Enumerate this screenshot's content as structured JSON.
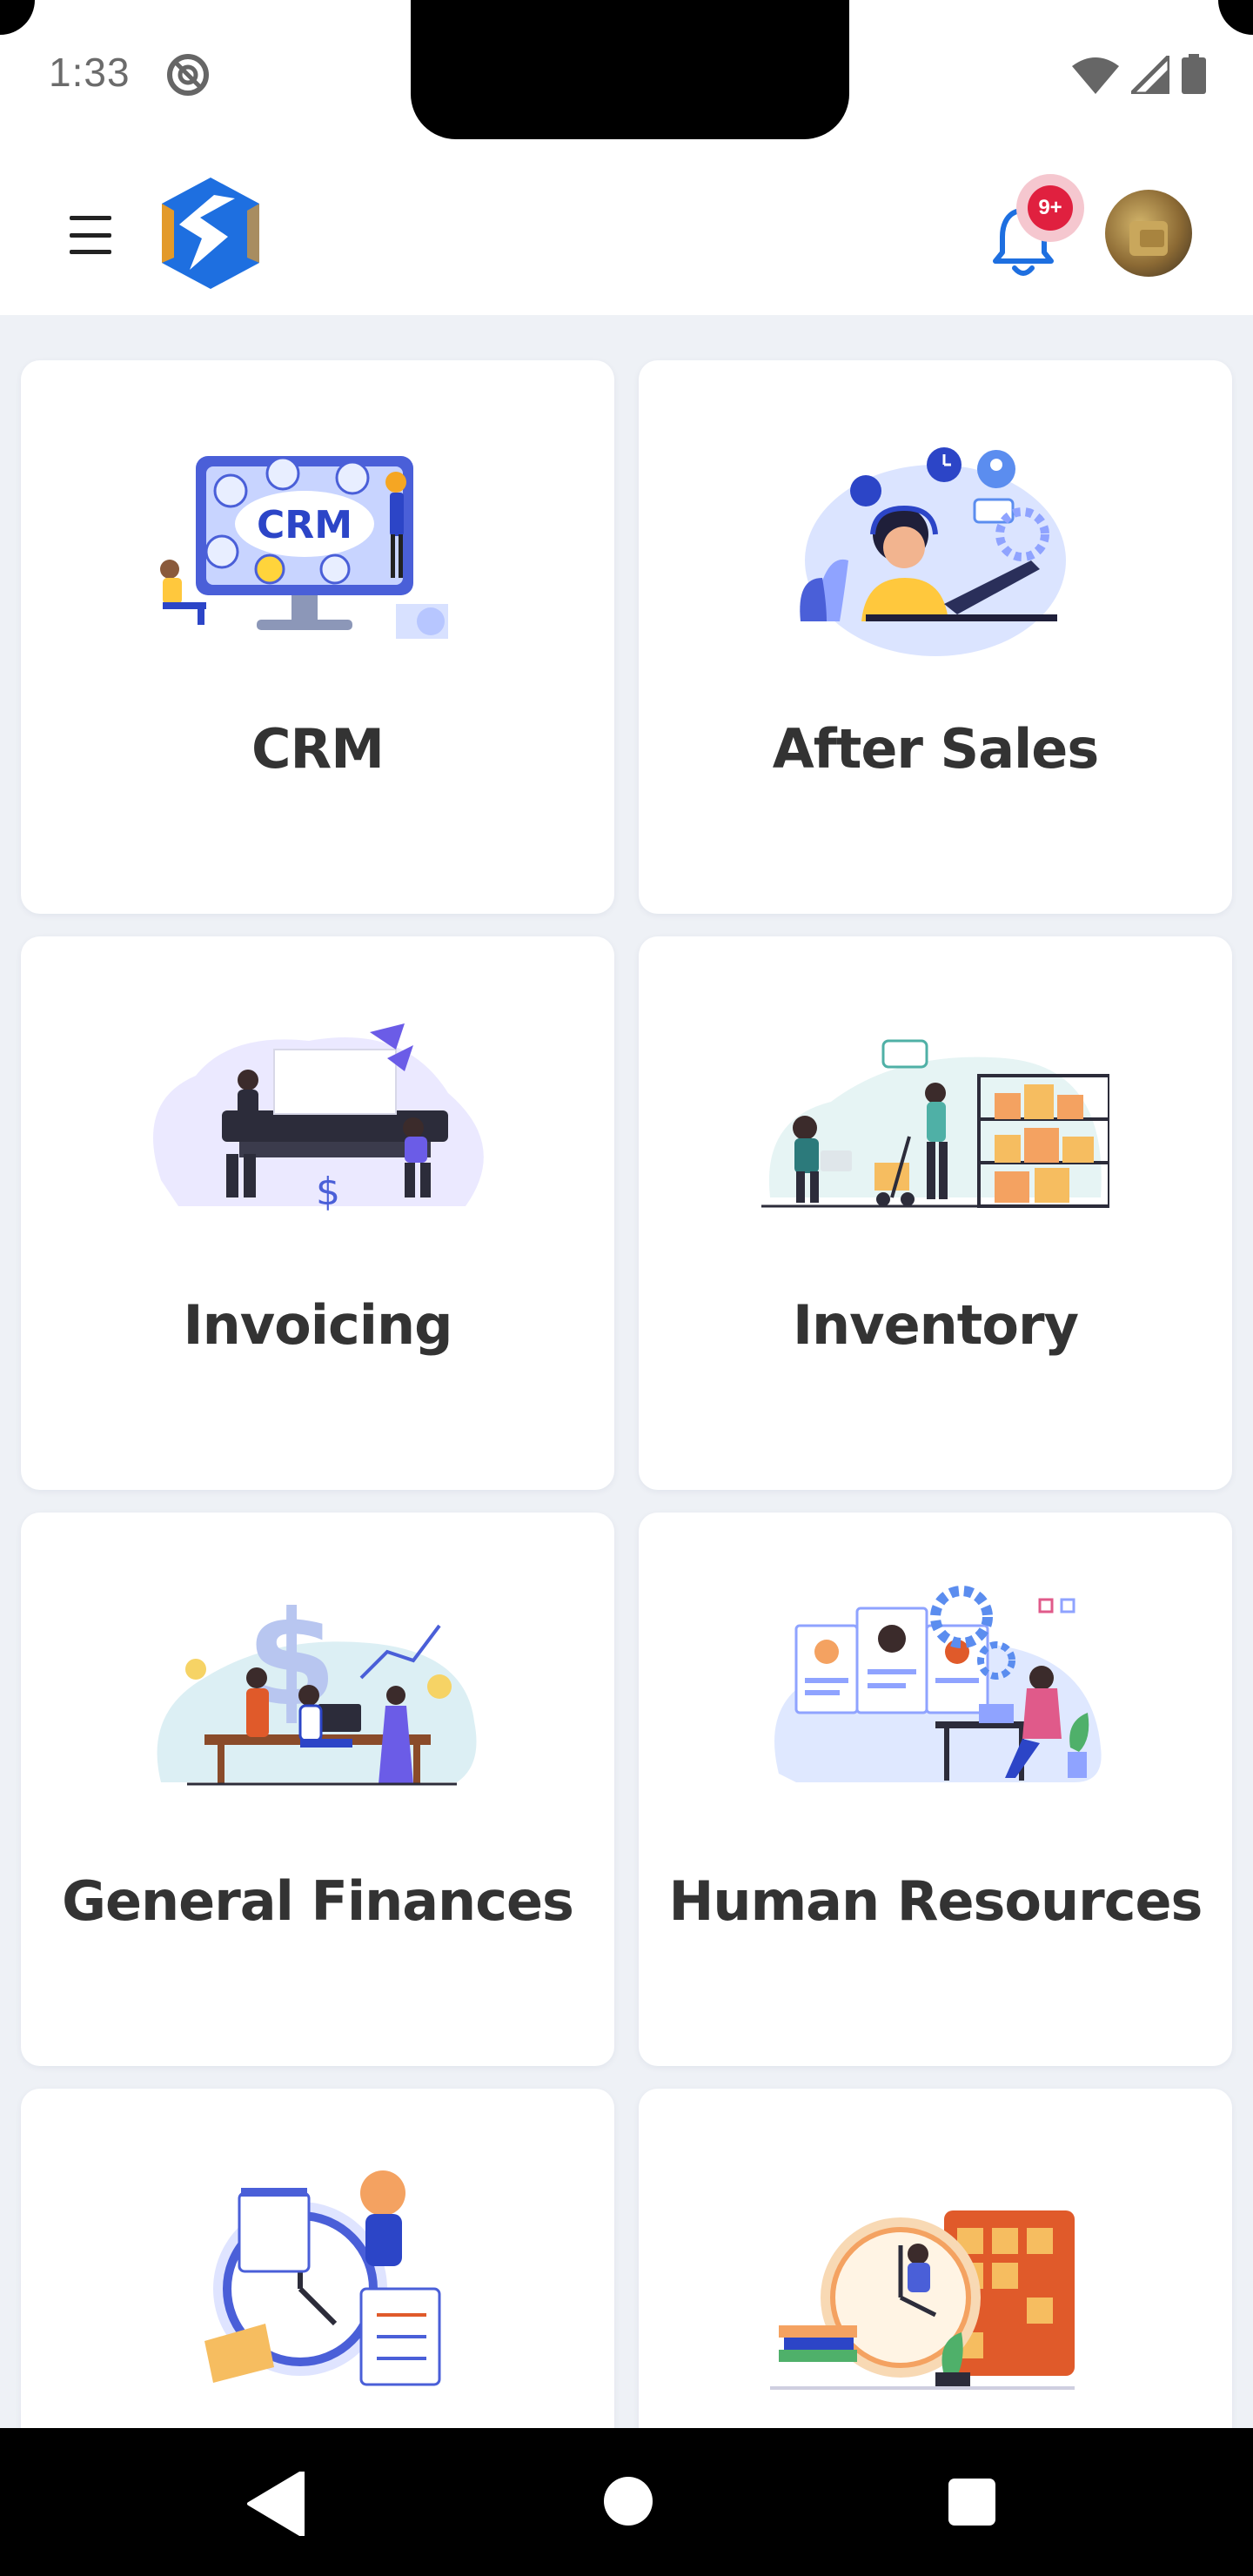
{
  "status_bar": {
    "time": "1:33",
    "icons": [
      "do-not-disturb-icon",
      "wifi-icon",
      "cellular-signal-icon",
      "battery-icon"
    ]
  },
  "header": {
    "menu_icon": "hamburger-menu-icon",
    "logo": "app-logo",
    "notifications": {
      "icon": "bell-icon",
      "badge": "9+"
    },
    "avatar": "user-avatar"
  },
  "modules": [
    {
      "label": "CRM",
      "illustration": "crm-illustration",
      "illustration_text": "CRM"
    },
    {
      "label": "After Sales",
      "illustration": "after-sales-illustration"
    },
    {
      "label": "Invoicing",
      "illustration": "invoicing-illustration",
      "illustration_text": "$"
    },
    {
      "label": "Inventory",
      "illustration": "inventory-illustration"
    },
    {
      "label": "General Finances",
      "illustration": "general-finances-illustration",
      "illustration_text": "$"
    },
    {
      "label": "Human Resources",
      "illustration": "human-resources-illustration"
    },
    {
      "label": "",
      "illustration": "time-tracking-illustration"
    },
    {
      "label": "",
      "illustration": "planning-illustration"
    }
  ],
  "colors": {
    "accent": "#1e6fe0",
    "badge": "#e0203f",
    "background": "#eef1f6",
    "card": "#ffffff",
    "label": "#333333"
  },
  "nav_bar": [
    "back-icon",
    "home-icon",
    "recents-icon"
  ]
}
